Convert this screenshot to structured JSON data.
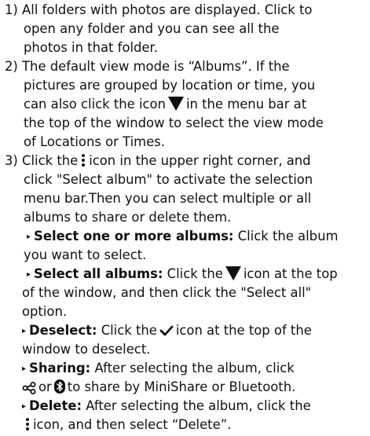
{
  "items": [
    {
      "number": "1)",
      "lines": [
        "All folders with photos are displayed. Click to",
        "open any folder and you can see all the",
        "photos in that folder."
      ]
    },
    {
      "number": "2)",
      "line1": "The default view mode is “Albums”. If the",
      "line2": "pictures are grouped by location or time, you",
      "line3a": "can also click the icon",
      "line3b": "in the menu bar at",
      "line4": "the top of the window to select the view mode",
      "line5": "of Locations or Times."
    },
    {
      "number": "3)",
      "line1a": "Click the",
      "line1b": "icon in the upper right corner, and",
      "line2": "click \"Select album\" to activate the selection",
      "line3": "menu bar.Then you can select multiple or all",
      "line4": "albums to share or delete them."
    }
  ],
  "bullets": {
    "select_one": {
      "label": "Select one or more albums:",
      "text1": "Click the album",
      "text2": "you want to select."
    },
    "select_all": {
      "label": "Select all albums:",
      "text1a": "Click the",
      "text1b": "icon at the top",
      "text2": "of the window, and then click the \"Select all\"",
      "text3": "option."
    },
    "deselect": {
      "label": "Deselect:",
      "text1a": "Click the",
      "text1b": "icon at the top of the",
      "text2": "window to deselect."
    },
    "sharing": {
      "label": "Sharing:",
      "text1": "After selecting the album, click",
      "text2a": "or",
      "text2b": "to share by MiniShare or Bluetooth."
    },
    "delete": {
      "label": "Delete:",
      "text1": "After selecting the album, click the",
      "text2": "icon, and then select “Delete”."
    }
  },
  "bullet_marker": "▸",
  "icons": [
    "triangle-down-icon",
    "more-vert-icon",
    "checkmark-icon",
    "share-icon",
    "bluetooth-icon"
  ]
}
